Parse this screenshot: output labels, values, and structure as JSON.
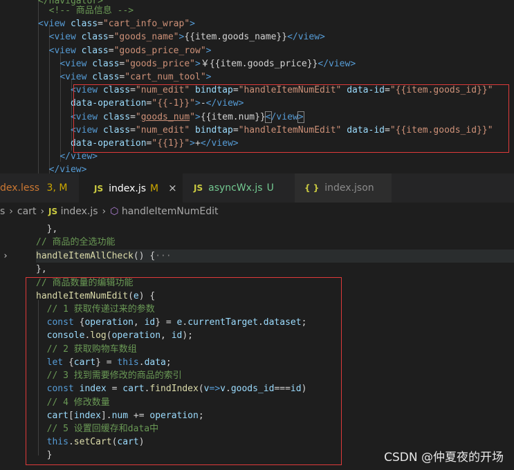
{
  "top_code": [
    "  <!-- 商品信息 -->",
    "  <view class=\"cart_info_wrap\">",
    "    <view class=\"goods_name\">{{item.goods_name}}</view>",
    "    <view class=\"goods_price_row\">",
    "      <view class=\"goods_price\">￥{{item.goods_price}}</view>",
    "      <view class=\"cart_num_tool\">",
    "        <view class=\"num_edit\" bindtap=\"handleItemNumEdit\" data-id=\"{{item.goods_id}}\"",
    "        data-operation=\"{{-1}}\">-</view>",
    "        <view class=\"goods_num\">{{item.num}}</view>",
    "        <view class=\"num_edit\" bindtap=\"handleItemNumEdit\" data-id=\"{{item.goods_id}}\"",
    "        data-operation=\"{{1}}\">+</view>",
    "      </view>",
    "    </view>"
  ],
  "tabs": [
    {
      "label": "dex.less",
      "status": "3, M"
    },
    {
      "icon": "JS",
      "label": "index.js",
      "status": "M",
      "close": "×"
    },
    {
      "icon": "JS",
      "label": "asyncWx.js",
      "status": "U"
    },
    {
      "icon": "{ }",
      "label": "index.json"
    }
  ],
  "breadcrumb": {
    "items": [
      "s",
      "cart",
      "index.js",
      "handleItemNumEdit"
    ],
    "js_icon": "JS"
  },
  "bottom_code": [
    "  },",
    "  // 商品的全选功能",
    "  handleItemAllCheck() {···",
    "  },",
    "  // 商品数量的编辑功能",
    "  handleItemNumEdit(e) {",
    "    // 1 获取传递过来的参数",
    "    const {operation, id} = e.currentTarget.dataset;",
    "    console.log(operation, id);",
    "    // 2 获取购物车数组",
    "    let {cart} = this.data;",
    "    // 3 找到需要修改的商品的索引",
    "    const index = cart.findIndex(v=>v.goods_id===id)",
    "    // 4 修改数量",
    "    cart[index].num += operation;",
    "    // 5 设置回缓存和data中",
    "    this.setCart(cart)",
    "  }"
  ],
  "fold_arrow": "›",
  "watermark": "CSDN @仲夏夜的开场",
  "colors": {
    "highlight_border": "#e03a3a",
    "editor_bg": "#1e1e1e"
  }
}
